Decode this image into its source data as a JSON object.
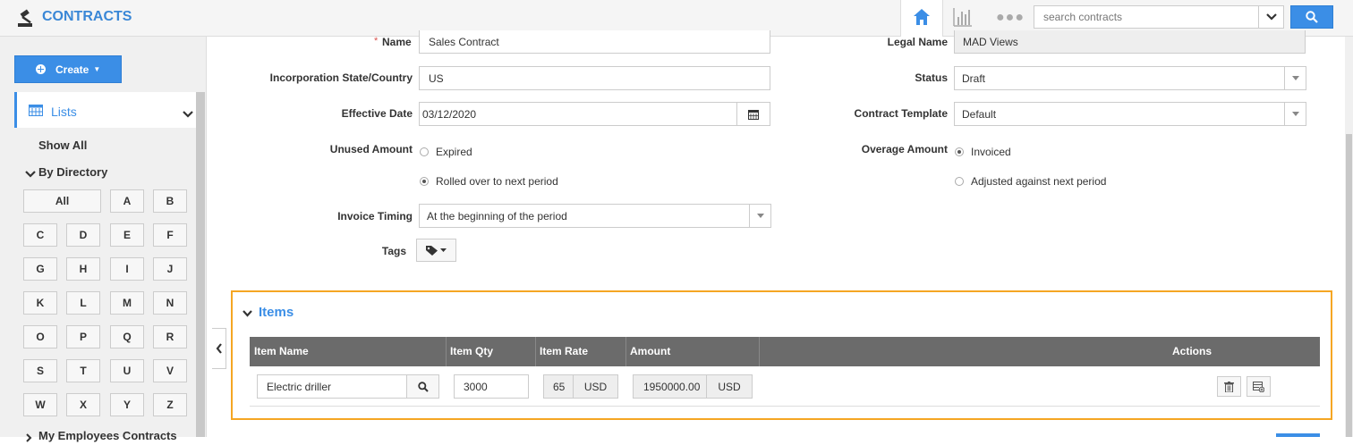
{
  "app": {
    "title": "CONTRACTS"
  },
  "search": {
    "placeholder": "search contracts"
  },
  "sidebar": {
    "create_label": "Create",
    "lists_label": "Lists",
    "show_all": "Show All",
    "by_directory": "By Directory",
    "letters": [
      "All",
      "A",
      "B",
      "C",
      "D",
      "E",
      "F",
      "G",
      "H",
      "I",
      "J",
      "K",
      "L",
      "M",
      "N",
      "O",
      "P",
      "Q",
      "R",
      "S",
      "T",
      "U",
      "V",
      "W",
      "X",
      "Y",
      "Z"
    ],
    "my_employees": "My Employees Contracts"
  },
  "form": {
    "name_label": "Name",
    "name_value": "Sales Contract",
    "legal_name_label": "Legal Name",
    "legal_name_value": "MAD Views",
    "incorporation_label": "Incorporation State/Country",
    "incorporation_value": "US",
    "status_label": "Status",
    "status_value": "Draft",
    "effective_date_label": "Effective Date",
    "effective_date_value": "03/12/2020",
    "contract_template_label": "Contract Template",
    "contract_template_value": "Default",
    "unused_amount_label": "Unused Amount",
    "unused_options": [
      "Expired",
      "Rolled over to next period"
    ],
    "overage_amount_label": "Overage Amount",
    "overage_options": [
      "Invoiced",
      "Adjusted against next period"
    ],
    "invoice_timing_label": "Invoice Timing",
    "invoice_timing_value": "At the beginning of the period",
    "tags_label": "Tags"
  },
  "items": {
    "title": "Items",
    "columns": [
      "Item Name",
      "Item Qty",
      "Item Rate",
      "Amount",
      "Actions"
    ],
    "rows": [
      {
        "name": "Electric driller",
        "qty": "3000",
        "rate": "65",
        "rate_currency": "USD",
        "amount": "1950000.00",
        "amount_currency": "USD"
      }
    ]
  },
  "colors": {
    "accent": "#3b8ee6",
    "highlight": "#f5a623",
    "table_header": "#6b6b6b"
  }
}
